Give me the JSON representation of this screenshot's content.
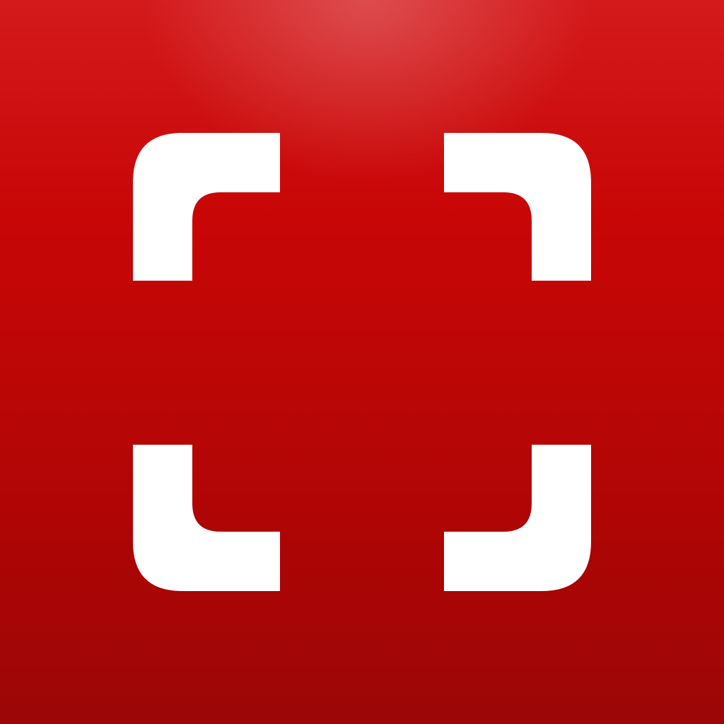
{
  "app_icon": {
    "icon": "scan-frame-icon",
    "colors": {
      "background_top": "#d41a1c",
      "background_bottom": "#9c0606",
      "glyph": "#ffffff"
    }
  }
}
